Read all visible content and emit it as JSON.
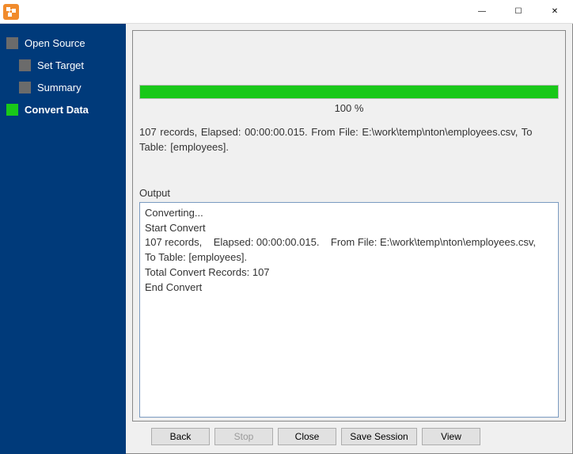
{
  "window": {
    "minimize_glyph": "—",
    "maximize_glyph": "☐",
    "close_glyph": "✕"
  },
  "sidebar": {
    "items": [
      {
        "label": "Open Source",
        "selected": false,
        "active": false,
        "child": false
      },
      {
        "label": "Set Target",
        "selected": false,
        "active": false,
        "child": true
      },
      {
        "label": "Summary",
        "selected": false,
        "active": false,
        "child": true
      },
      {
        "label": "Convert Data",
        "selected": true,
        "active": true,
        "child": false
      }
    ]
  },
  "progress": {
    "percent_label": "100 %",
    "percent_value": 100
  },
  "status_line": "107 records,    Elapsed: 00:00:00.015.    From File: E:\\work\\temp\\nton\\employees.csv,    To Table: [employees].",
  "output_label": "Output",
  "output_text": "Converting...\nStart Convert\n107 records,    Elapsed: 00:00:00.015.    From File: E:\\work\\temp\\nton\\employees.csv,    To Table: [employees].\nTotal Convert Records: 107\nEnd Convert\n",
  "buttons": {
    "back": "Back",
    "stop": "Stop",
    "close": "Close",
    "save_session": "Save Session",
    "view": "View"
  }
}
